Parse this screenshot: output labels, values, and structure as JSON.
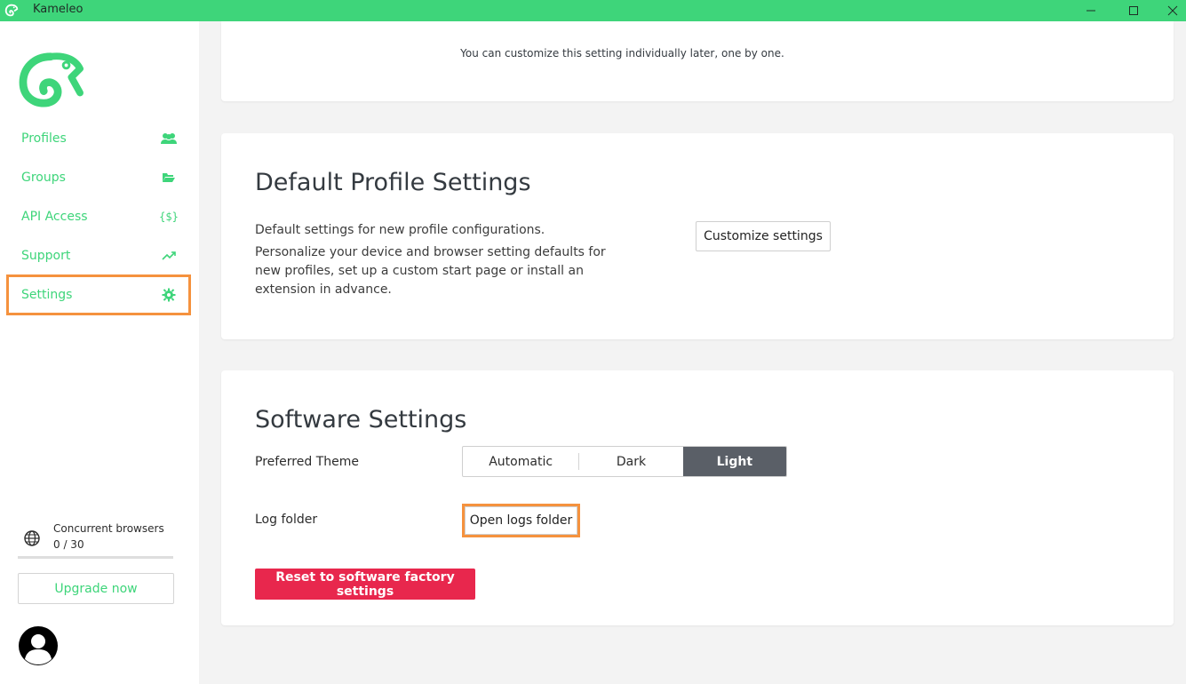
{
  "window": {
    "title": "Kameleo",
    "brand_color": "#3ed57a",
    "highlight_color": "#f5923e"
  },
  "sidebar": {
    "items": [
      {
        "label": "Profiles",
        "icon": "users-icon"
      },
      {
        "label": "Groups",
        "icon": "folder-open-icon"
      },
      {
        "label": "API Access",
        "icon": "code-braces-icon"
      },
      {
        "label": "Support",
        "icon": "trend-up-icon"
      },
      {
        "label": "Settings",
        "icon": "gear-icon",
        "active": true
      }
    ],
    "concurrent": {
      "label": "Concurrent browsers",
      "count": "0 / 30",
      "used_fraction": 0.0
    },
    "upgrade_label": "Upgrade now"
  },
  "main": {
    "top_note": "You can customize this setting individually later, one by one.",
    "default_profile": {
      "title": "Default Profile Settings",
      "desc1": "Default settings for new profile configurations.",
      "desc2": "Personalize your device and browser setting defaults for new profiles, set up a custom start page or install an extension in advance.",
      "button_label": "Customize settings"
    },
    "software": {
      "title": "Software Settings",
      "theme_label": "Preferred Theme",
      "theme_options": [
        "Automatic",
        "Dark",
        "Light"
      ],
      "theme_selected": "Light",
      "log_label": "Log folder",
      "open_logs_label": "Open logs folder",
      "reset_label": "Reset to software factory settings",
      "reset_color": "#e8274d"
    }
  }
}
